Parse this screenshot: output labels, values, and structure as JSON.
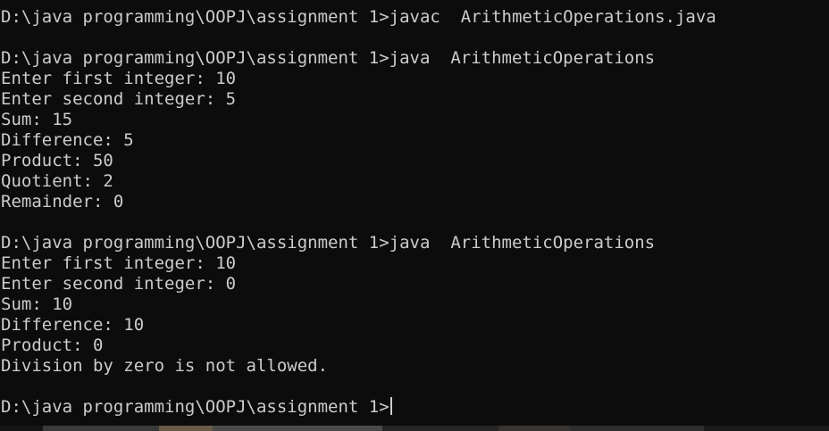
{
  "terminal": {
    "lines": [
      "D:\\java programming\\OOPJ\\assignment 1>javac  ArithmeticOperations.java",
      "",
      "D:\\java programming\\OOPJ\\assignment 1>java  ArithmeticOperations",
      "Enter first integer: 10",
      "Enter second integer: 5",
      "Sum: 15",
      "Difference: 5",
      "Product: 50",
      "Quotient: 2",
      "Remainder: 0",
      "",
      "D:\\java programming\\OOPJ\\assignment 1>java  ArithmeticOperations",
      "Enter first integer: 10",
      "Enter second integer: 0",
      "Sum: 10",
      "Difference: 10",
      "Product: 0",
      "Division by zero is not allowed.",
      "",
      "D:\\java programming\\OOPJ\\assignment 1>"
    ],
    "colors": {
      "background": "#0c0c0c",
      "text": "#cccccc"
    }
  }
}
